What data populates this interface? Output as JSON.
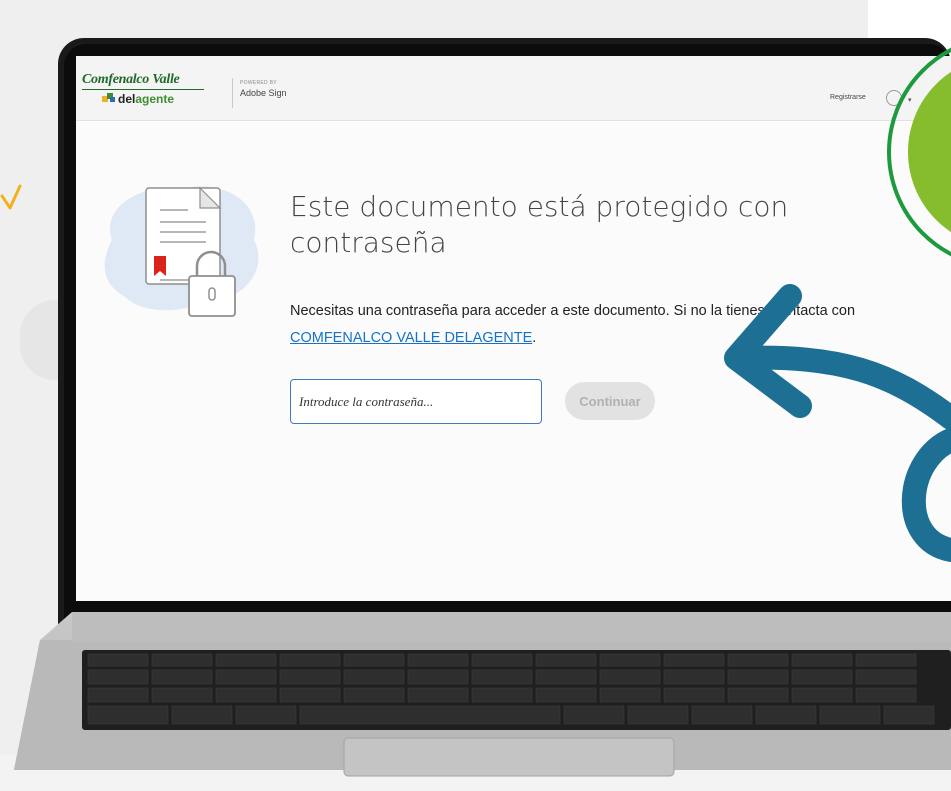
{
  "app": {
    "logo_title": "Comfenalco Valle",
    "logo_subtitle_a": "del",
    "logo_subtitle_b": "agente",
    "powered_by": "POWERED BY",
    "product": "Adobe Sign",
    "register_label": "Registrarse"
  },
  "dialog": {
    "title": "Este documento está protegido con contraseña",
    "description_prefix": "Necesitas una contraseña para acceder a este documento. Si no la tienes, contacta con ",
    "contact_link": "COMFENALCO VALLE DELAGENTE",
    "description_suffix": ".",
    "password_placeholder": "Introduce la contraseña...",
    "continue_label": "Continuar"
  },
  "icons": {
    "document": "document-lock-icon",
    "help": "help-circle-icon",
    "menu": "chevron-down-icon"
  },
  "colors": {
    "link": "#1473c7",
    "input_border": "#3f78c4",
    "button_disabled_bg": "#e2e2e2",
    "brand_green": "#1e6b2a",
    "deco_green": "#85bd2c",
    "deco_ring": "#1e9a3e",
    "deco_arrow": "#1d6f94",
    "deco_chevron": "#f2b21c"
  }
}
